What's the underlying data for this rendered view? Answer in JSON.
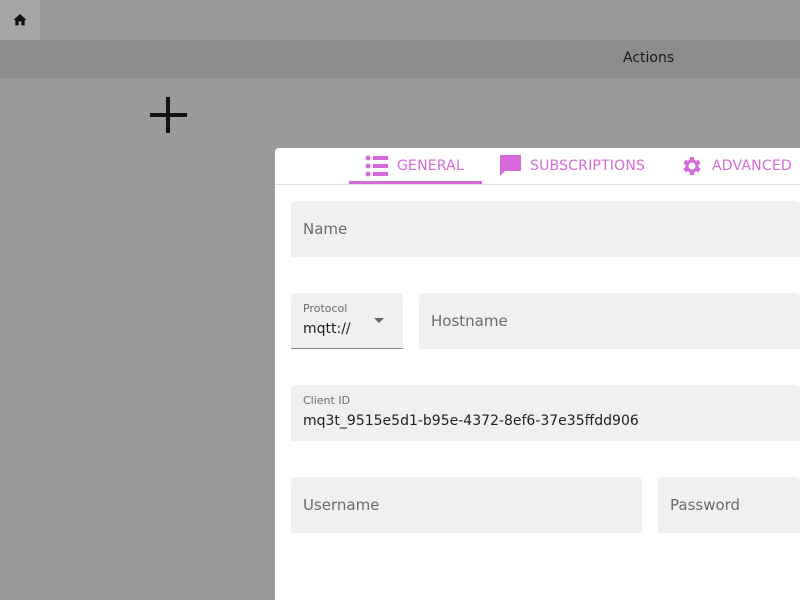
{
  "header": {
    "home_icon": "home-icon",
    "actions_label": "Actions",
    "add_icon": "plus-icon"
  },
  "dialog": {
    "accent_color": "#d66ad9",
    "tabs": [
      {
        "label": "GENERAL",
        "icon": "list-icon",
        "active": true
      },
      {
        "label": "SUBSCRIPTIONS",
        "icon": "chat-icon",
        "active": false
      },
      {
        "label": "ADVANCED",
        "icon": "gear-icon",
        "active": false
      }
    ],
    "fields": {
      "name": {
        "placeholder": "Name",
        "value": ""
      },
      "protocol": {
        "label": "Protocol",
        "value": "mqtt://"
      },
      "hostname": {
        "placeholder": "Hostname",
        "value": ""
      },
      "client_id": {
        "label": "Client ID",
        "value": "mq3t_9515e5d1-b95e-4372-8ef6-37e35ffdd906"
      },
      "username": {
        "placeholder": "Username",
        "value": ""
      },
      "password": {
        "placeholder": "Password",
        "value": ""
      }
    }
  }
}
